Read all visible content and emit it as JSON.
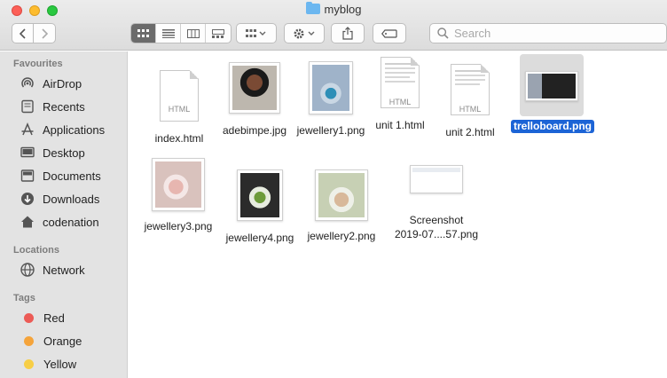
{
  "window": {
    "title": "myblog"
  },
  "toolbar": {
    "search_placeholder": "Search"
  },
  "sidebar": {
    "favourites_header": "Favourites",
    "favourites": [
      {
        "label": "AirDrop",
        "icon": "airdrop-icon"
      },
      {
        "label": "Recents",
        "icon": "recents-icon"
      },
      {
        "label": "Applications",
        "icon": "applications-icon"
      },
      {
        "label": "Desktop",
        "icon": "desktop-icon"
      },
      {
        "label": "Documents",
        "icon": "documents-icon"
      },
      {
        "label": "Downloads",
        "icon": "downloads-icon"
      },
      {
        "label": "codenation",
        "icon": "home-icon"
      }
    ],
    "locations_header": "Locations",
    "locations": [
      {
        "label": "Network",
        "icon": "network-icon"
      }
    ],
    "tags_header": "Tags",
    "tags": [
      {
        "label": "Red",
        "color": "#ec5b56"
      },
      {
        "label": "Orange",
        "color": "#f5a43b"
      },
      {
        "label": "Yellow",
        "color": "#f7ce46"
      }
    ]
  },
  "files": [
    {
      "name": "index.html",
      "kind": "html"
    },
    {
      "name": "adebimpe.jpg",
      "kind": "image"
    },
    {
      "name": "jewellery1.png",
      "kind": "image"
    },
    {
      "name": "unit 1.html",
      "kind": "html"
    },
    {
      "name": "unit 2.html",
      "kind": "html"
    },
    {
      "name": "trelloboard.png",
      "kind": "image",
      "selected": true
    },
    {
      "name": "jewellery3.png",
      "kind": "image"
    },
    {
      "name": "jewellery4.png",
      "kind": "image"
    },
    {
      "name": "jewellery2.png",
      "kind": "image"
    },
    {
      "name_line1": "Screenshot",
      "name_line2": "2019-07....57.png",
      "kind": "image"
    }
  ],
  "icon_text": {
    "html": "HTML"
  },
  "colors": {
    "selection": "#1c64d6",
    "sidebar_bg": "#e3e3e3",
    "folder": "#6cb7f0"
  }
}
